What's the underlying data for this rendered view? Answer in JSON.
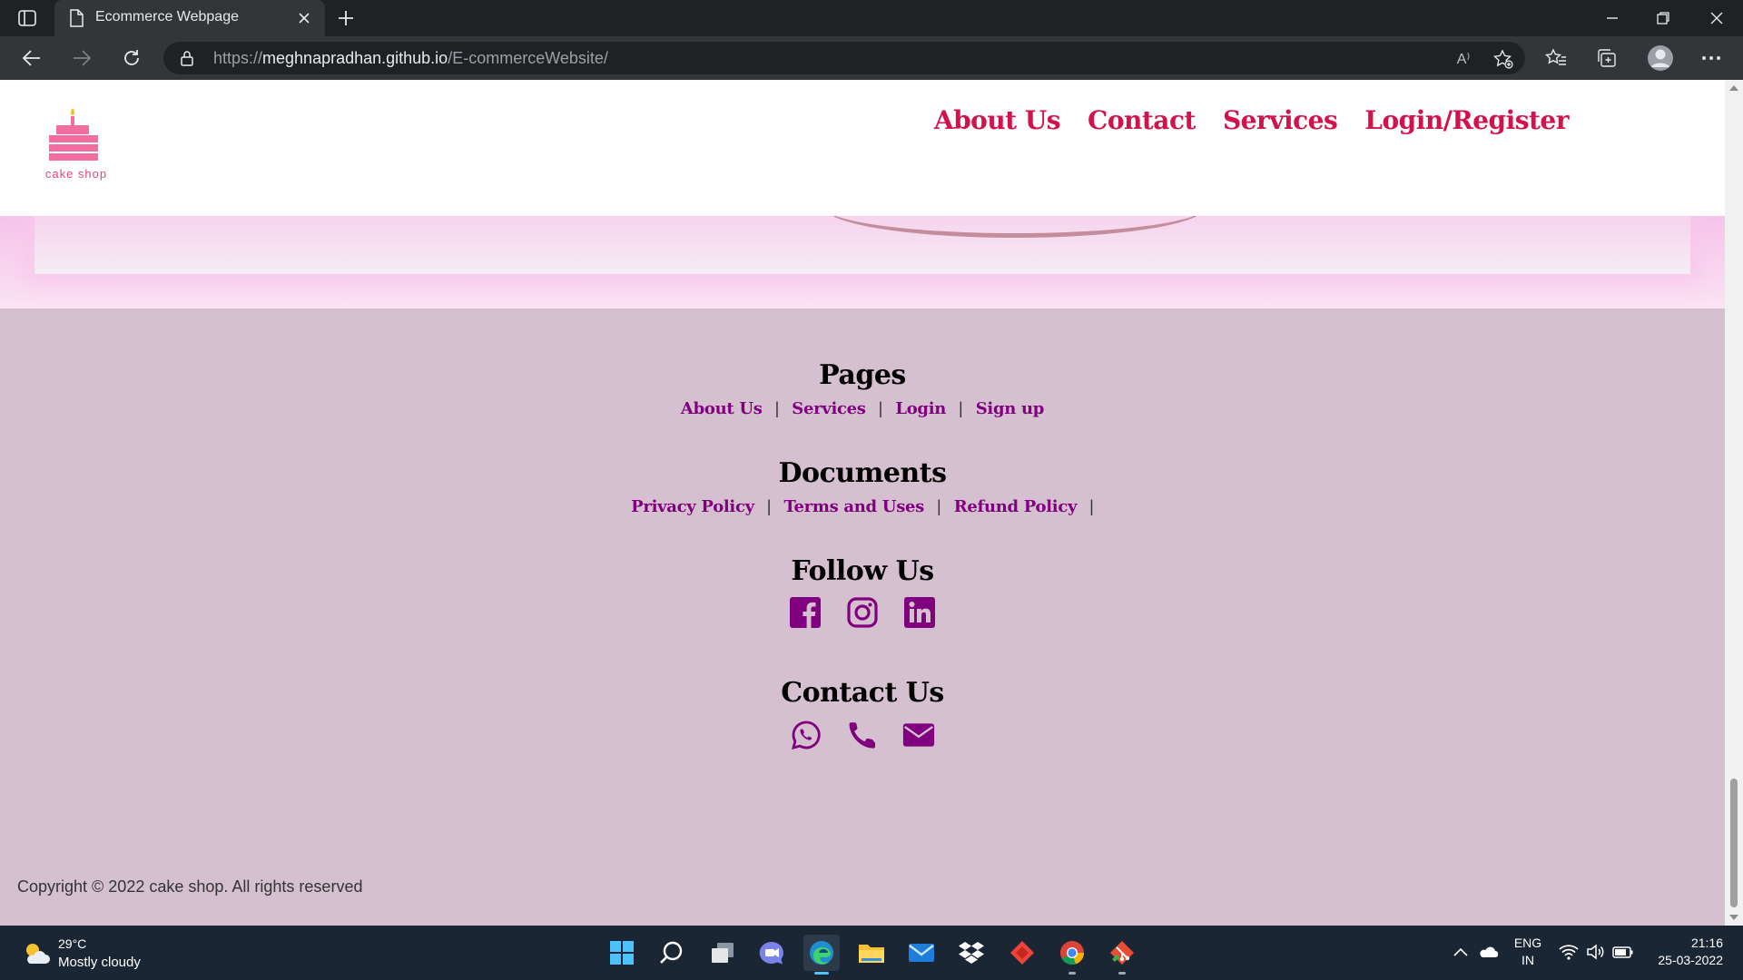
{
  "browser": {
    "tab_title": "Ecommerce Webpage",
    "url_prefix": "https://",
    "url_host": "meghnapradhan.github.io",
    "url_path": "/E-commerceWebsite/",
    "read_aloud_label": "A⁾"
  },
  "site": {
    "logo_text": "cake shop",
    "nav": [
      "About Us",
      "Contact",
      "Services",
      "Login/Register"
    ],
    "brand_colors": {
      "nav": "#d3114a",
      "footer_link": "#800080",
      "footer_bg": "#d5c0d0",
      "logo": "#e8447c"
    }
  },
  "footer": {
    "pages_heading": "Pages",
    "pages_links": [
      "About Us",
      "Services",
      "Login",
      "Sign up"
    ],
    "documents_heading": "Documents",
    "documents_links": [
      "Privacy Policy",
      "Terms and Uses",
      "Refund Policy"
    ],
    "follow_heading": "Follow Us",
    "follow_icons": [
      "facebook-icon",
      "instagram-icon",
      "linkedin-icon"
    ],
    "contact_heading": "Contact Us",
    "contact_icons": [
      "whatsapp-icon",
      "phone-icon",
      "envelope-icon"
    ],
    "separator": "|",
    "copyright": "Copyright © 2022 cake shop. All rights reserved"
  },
  "taskbar": {
    "temperature": "29°C",
    "weather": "Mostly cloudy",
    "lang_line1": "ENG",
    "lang_line2": "IN",
    "time": "21:16",
    "date": "25-03-2022",
    "apps": [
      "start-icon",
      "search-icon",
      "task-view-icon",
      "chat-icon",
      "edge-icon",
      "file-explorer-icon",
      "mail-icon",
      "dropbox-icon",
      "anydesk-icon",
      "chrome-icon",
      "git-icon"
    ]
  }
}
